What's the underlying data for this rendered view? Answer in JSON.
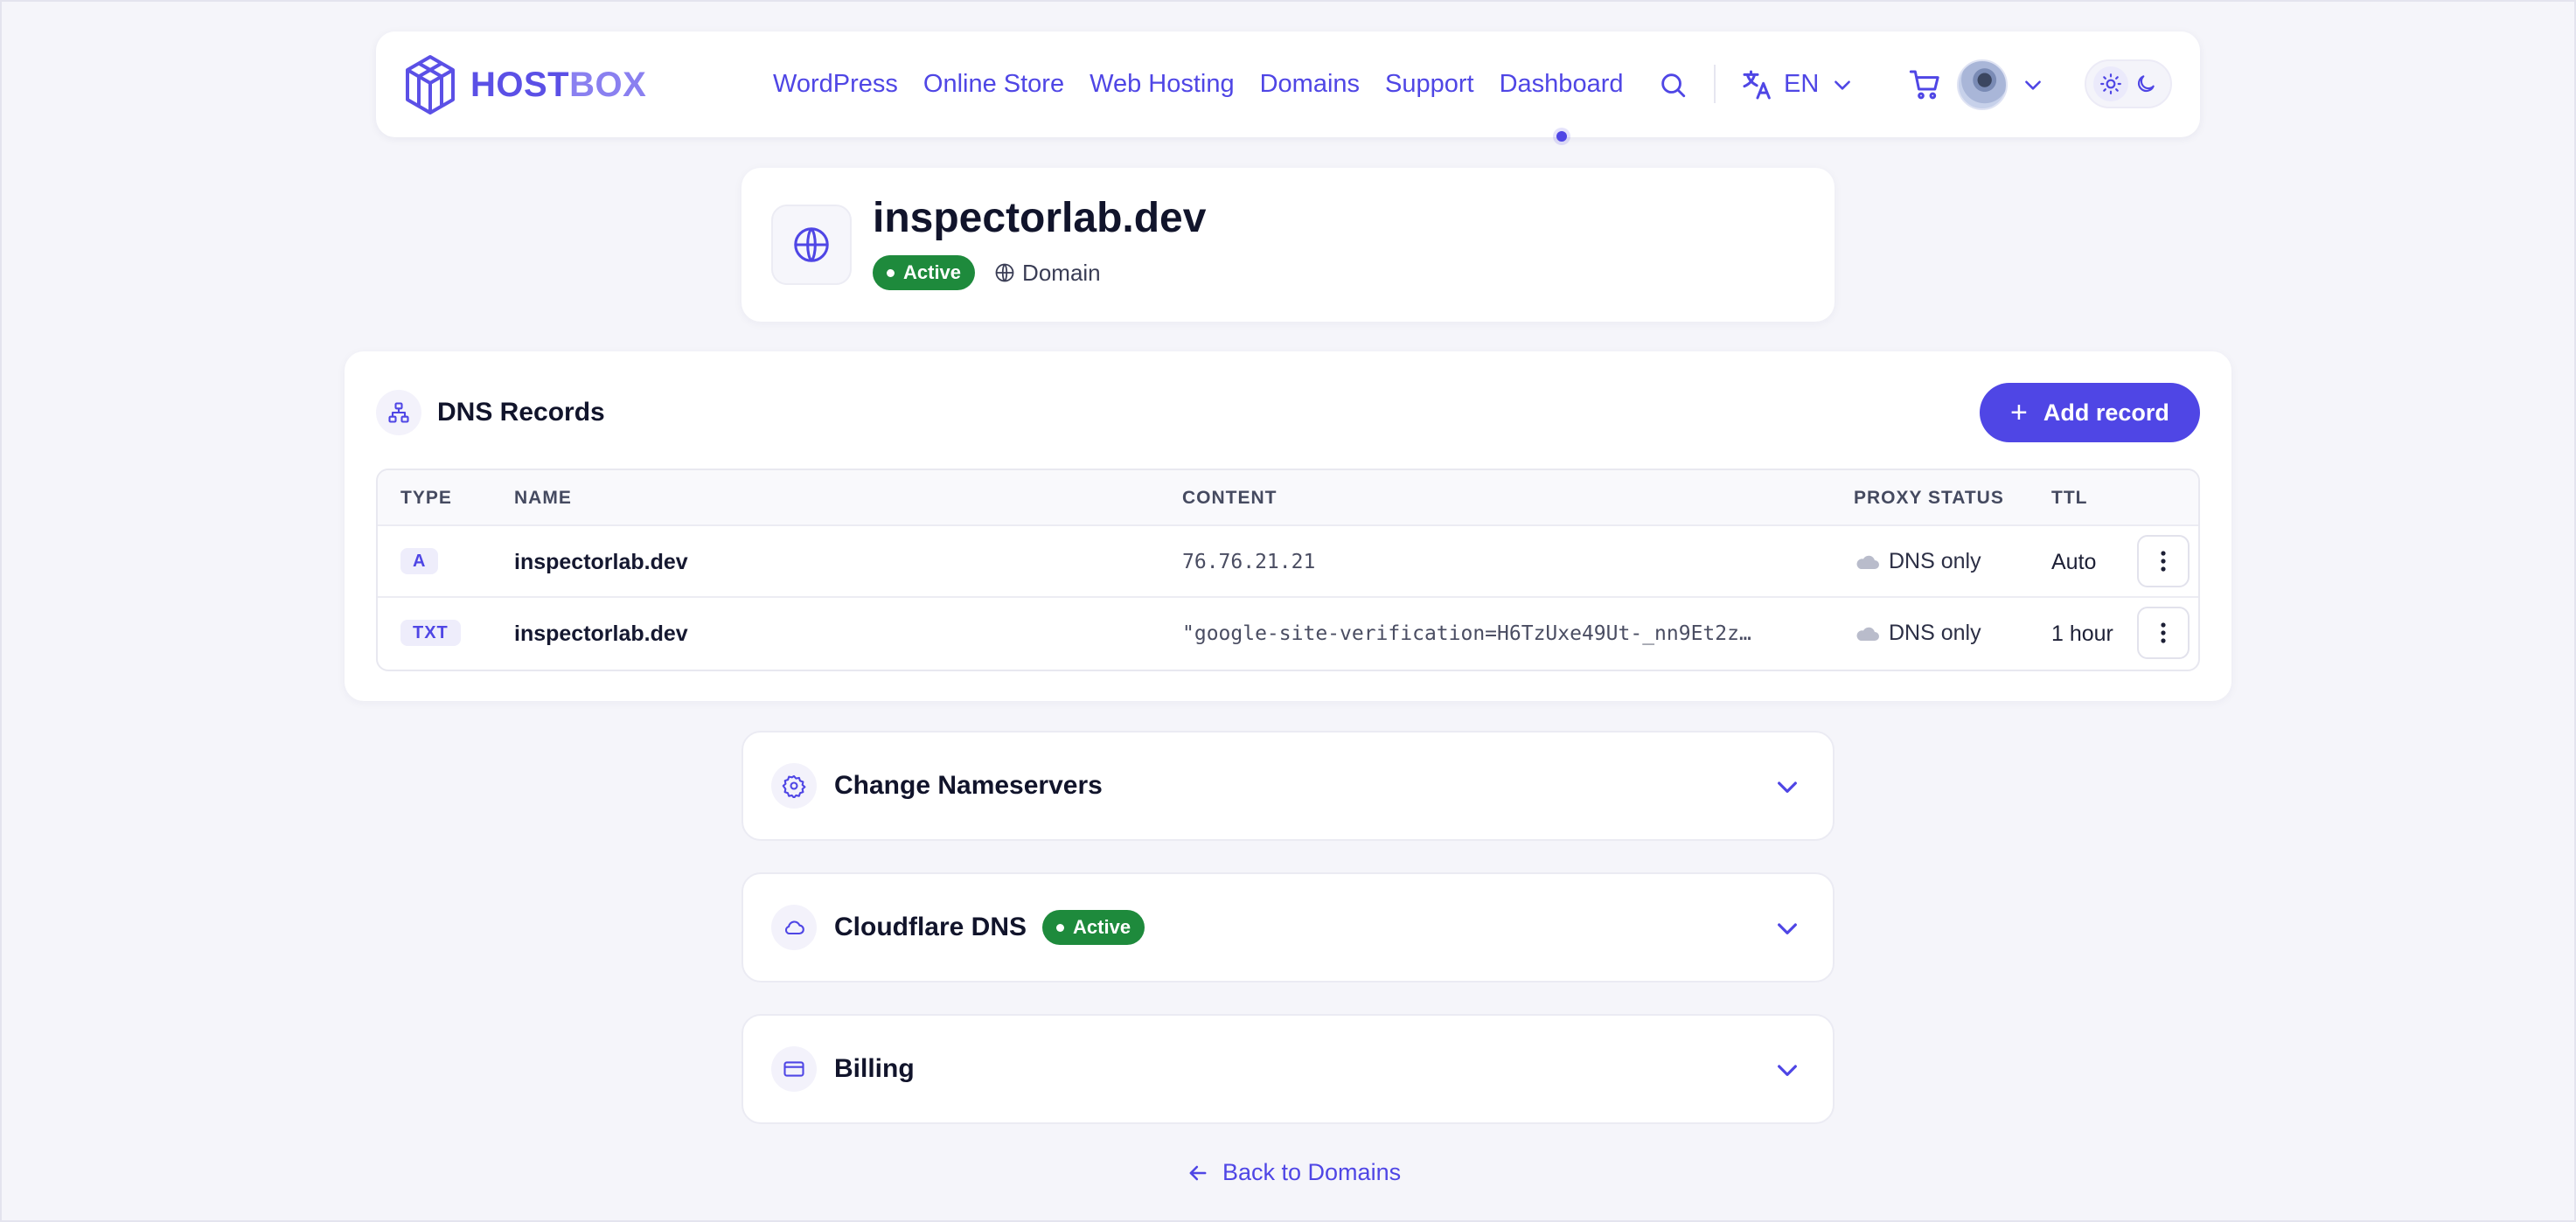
{
  "brand": {
    "host": "HOST",
    "box": "BOX"
  },
  "nav": {
    "links": [
      "WordPress",
      "Online Store",
      "Web Hosting",
      "Domains",
      "Support",
      "Dashboard"
    ],
    "language": "EN"
  },
  "domain": {
    "title": "inspectorlab.dev",
    "status": "Active",
    "kind": "Domain"
  },
  "dns": {
    "title": "DNS Records",
    "add_label": "Add record",
    "columns": {
      "type": "TYPE",
      "name": "NAME",
      "content": "CONTENT",
      "proxy": "PROXY STATUS",
      "ttl": "TTL"
    },
    "records": [
      {
        "type": "A",
        "name": "inspectorlab.dev",
        "content": "76.76.21.21",
        "proxy": "DNS only",
        "ttl": "Auto"
      },
      {
        "type": "TXT",
        "name": "inspectorlab.dev",
        "content": "\"google-site-verification=H6TzUxe49Ut-_nn9Et2z…",
        "proxy": "DNS only",
        "ttl": "1 hour"
      }
    ]
  },
  "sections": {
    "nameservers": "Change Nameservers",
    "cloudflare": "Cloudflare DNS",
    "cloudflare_status": "Active",
    "billing": "Billing"
  },
  "back_label": "Back to Domains",
  "colors": {
    "accent": "#4f46e5",
    "active": "#1e8a3c",
    "background": "#f5f5fa"
  }
}
